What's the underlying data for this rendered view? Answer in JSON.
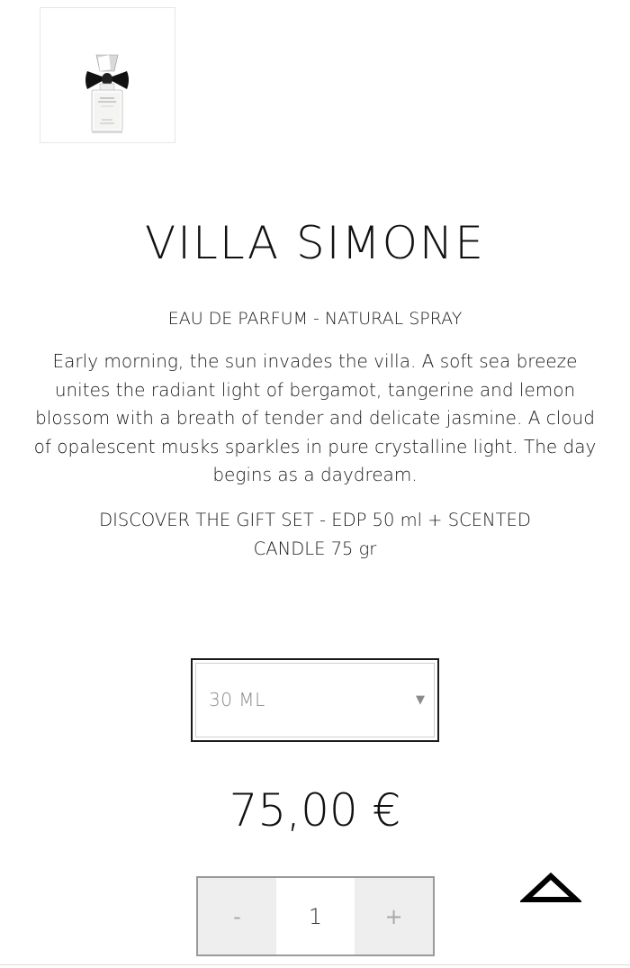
{
  "product": {
    "title": "VILLA SIMONE",
    "subtitle": "EAU DE PARFUM - NATURAL SPRAY",
    "description": "Early morning, the sun invades the villa. A soft sea breeze unites the radiant light of bergamot, tangerine and lemon blossom with a breath of tender and delicate jasmine. A cloud of opalescent musks sparkles in pure crystalline light. The day begins as a daydream.",
    "gift_link": "DISCOVER THE GIFT SET - EDP 50 ml + SCENTED CANDLE 75 gr",
    "thumbnail_icon": "perfume-bottle-thumbnail"
  },
  "size_select": {
    "selected": "30 ML",
    "caret_icon": "chevron-down-icon",
    "caret_glyph": "▼"
  },
  "price": "75,00 €",
  "quantity": {
    "minus_label": "-",
    "value": "1",
    "plus_label": "+"
  },
  "scroll_top": {
    "icon": "triangle-up-icon"
  },
  "colors": {
    "text": "#1a1a1a",
    "muted": "#8a8a8a",
    "qty_bg": "#eeeeee",
    "border": "#9a9a9a"
  }
}
